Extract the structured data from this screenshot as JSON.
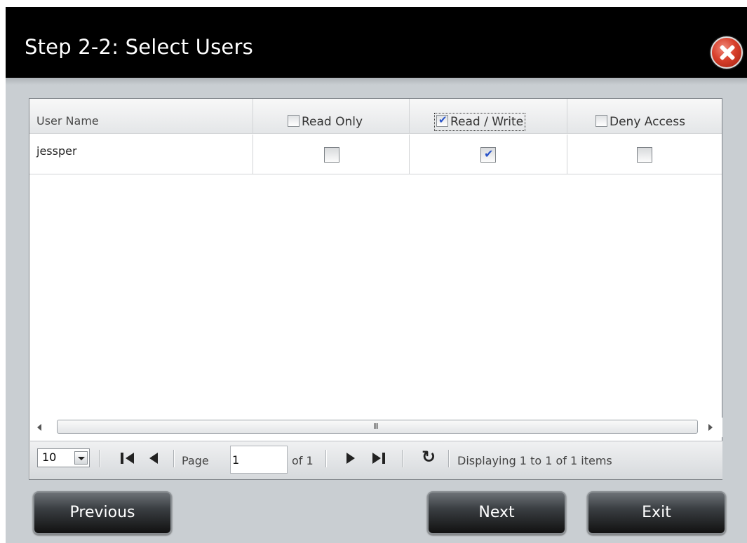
{
  "dialog": {
    "title": "Step 2-2: Select Users"
  },
  "grid": {
    "columns": {
      "user": "User Name",
      "read_only": "Read Only",
      "read_write": "Read / Write",
      "deny": "Deny Access"
    },
    "header_checks": {
      "read_only": false,
      "read_write": true,
      "deny": false
    },
    "rows": [
      {
        "name": "jessper",
        "read_only": false,
        "read_write": true,
        "deny": false
      }
    ],
    "scroll_grip": "III"
  },
  "pager": {
    "page_size": "10",
    "page_label": "Page",
    "page_value": "1",
    "of_label": "of 1",
    "display_text": "Displaying 1 to 1 of 1 items"
  },
  "buttons": {
    "previous": "Previous",
    "next": "Next",
    "exit": "Exit"
  }
}
